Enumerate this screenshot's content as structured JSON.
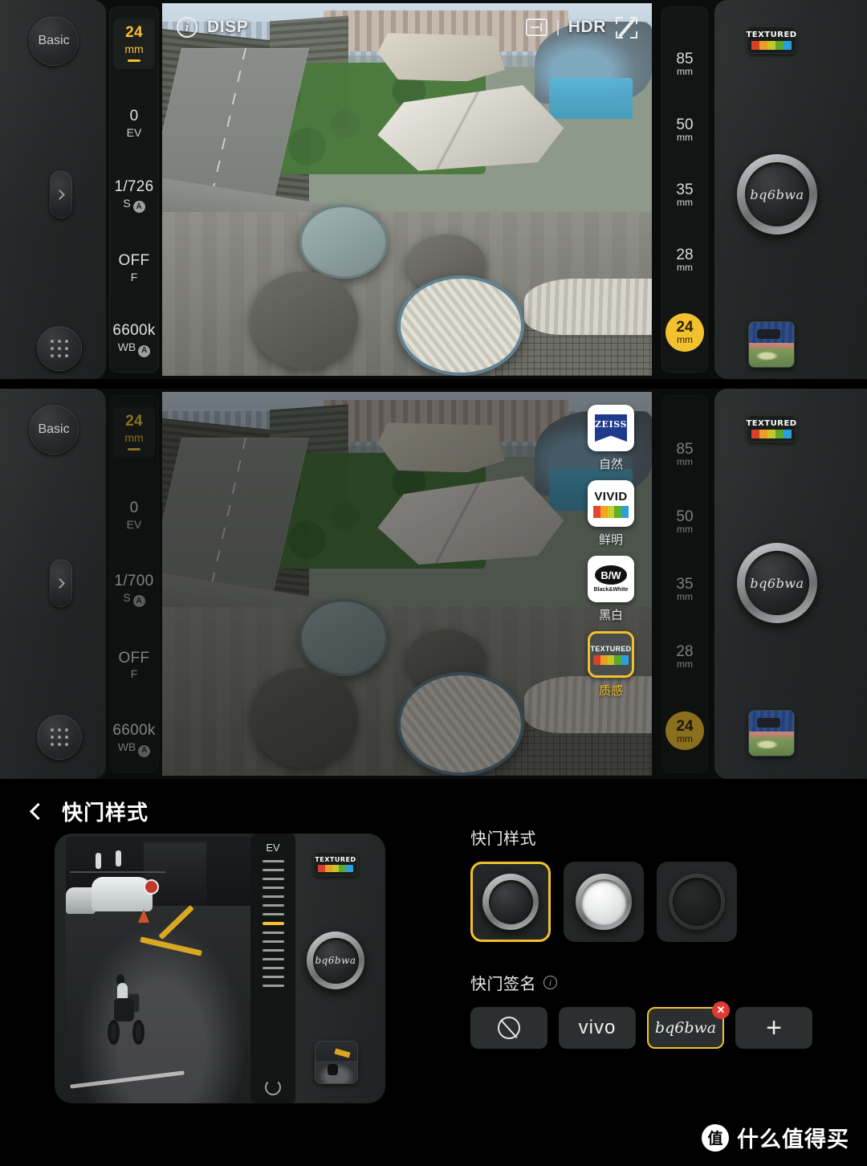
{
  "shot1": {
    "left_panel": {
      "mode_button": "Basic",
      "expand_icon": "chevron-right",
      "grid_icon": "grid-dots"
    },
    "settings_rail": {
      "focal": {
        "value": "24",
        "unit": "mm"
      },
      "ev": {
        "value": "0",
        "label": "EV"
      },
      "shutter": {
        "value": "1/726",
        "label": "S",
        "auto": "A"
      },
      "flash": {
        "value": "OFF",
        "label": "F"
      },
      "wb": {
        "value": "6600k",
        "label": "WB",
        "auto": "A"
      }
    },
    "top_bar": {
      "info_icon": "info-icon",
      "disp_label": "DISP",
      "meter_icon": "exposure-meter-icon",
      "separator": "|",
      "hdr_label": "HDR",
      "scan_icon": "scan-off-icon"
    },
    "focal_scale": {
      "steps": [
        {
          "value": "85",
          "unit": "mm",
          "active": false
        },
        {
          "value": "50",
          "unit": "mm",
          "active": false
        },
        {
          "value": "35",
          "unit": "mm",
          "active": false
        },
        {
          "value": "28",
          "unit": "mm",
          "active": false
        },
        {
          "value": "24",
          "unit": "mm",
          "active": true
        }
      ]
    },
    "right_panel": {
      "style_badge": "TEXTURED",
      "shutter_signature": "bq6bwa",
      "gallery_thumb": "stadium-photo"
    }
  },
  "shot2": {
    "left_panel": {
      "mode_button": "Basic",
      "expand_icon": "chevron-right",
      "grid_icon": "grid-dots"
    },
    "settings_rail": {
      "focal": {
        "value": "24",
        "unit": "mm"
      },
      "ev": {
        "value": "0",
        "label": "EV"
      },
      "shutter": {
        "value": "1/700",
        "label": "S",
        "auto": "A"
      },
      "flash": {
        "value": "OFF",
        "label": "F"
      },
      "wb": {
        "value": "6600k",
        "label": "WB",
        "auto": "A"
      }
    },
    "focal_scale": {
      "steps": [
        {
          "value": "85",
          "unit": "mm",
          "active": false
        },
        {
          "value": "50",
          "unit": "mm",
          "active": false
        },
        {
          "value": "35",
          "unit": "mm",
          "active": false
        },
        {
          "value": "28",
          "unit": "mm",
          "active": false
        },
        {
          "value": "24",
          "unit": "mm",
          "active": true
        }
      ]
    },
    "right_panel": {
      "style_badge": "TEXTURED",
      "shutter_signature": "bq6bwa",
      "gallery_thumb": "stadium-photo"
    },
    "style_picker": {
      "items": [
        {
          "brand": "ZEISS",
          "label": "自然",
          "selected": false
        },
        {
          "brand": "VIVID",
          "label": "鲜明",
          "selected": false
        },
        {
          "brand": "B/W",
          "brand_sub": "Black&White",
          "label": "黑白",
          "selected": false
        },
        {
          "brand": "TEXTURED",
          "label": "质感",
          "selected": true
        }
      ]
    }
  },
  "settings": {
    "header": {
      "back_icon": "chevron-left",
      "title": "快门样式"
    },
    "preview": {
      "ev_label": "EV",
      "style_badge": "TEXTURED",
      "signature": "bq6bwa",
      "reset_icon": "reset-icon",
      "thumb": "motorcycle-photo"
    },
    "shutter_style": {
      "title": "快门样式",
      "options": [
        {
          "name": "dark-ring-shutter",
          "selected": true
        },
        {
          "name": "white-shutter",
          "selected": false
        },
        {
          "name": "flat-dark-shutter",
          "selected": false
        }
      ]
    },
    "shutter_signature": {
      "title": "快门签名",
      "info_icon": "info-icon",
      "options": [
        {
          "type": "none",
          "label": "",
          "icon": "no-sign-icon",
          "selected": false
        },
        {
          "type": "text",
          "label": "vivo",
          "selected": false
        },
        {
          "type": "text",
          "label": "bq6bwa",
          "selected": true,
          "deletable": true,
          "delete_label": "✕"
        },
        {
          "type": "add",
          "label": "+",
          "selected": false
        }
      ]
    }
  },
  "watermark": {
    "logo": "值",
    "text": "什么值得买"
  },
  "colors": {
    "accent_yellow": "#f2c12e",
    "delete_red": "#e03b30",
    "zeiss_blue": "#1e3a8f",
    "tex_bar_red": "#d9402c",
    "tex_bar_orange": "#e8a024",
    "tex_bar_yellow": "#c8c52c",
    "tex_bar_green": "#5aa82e",
    "tex_bar_blue": "#2b9ede"
  }
}
